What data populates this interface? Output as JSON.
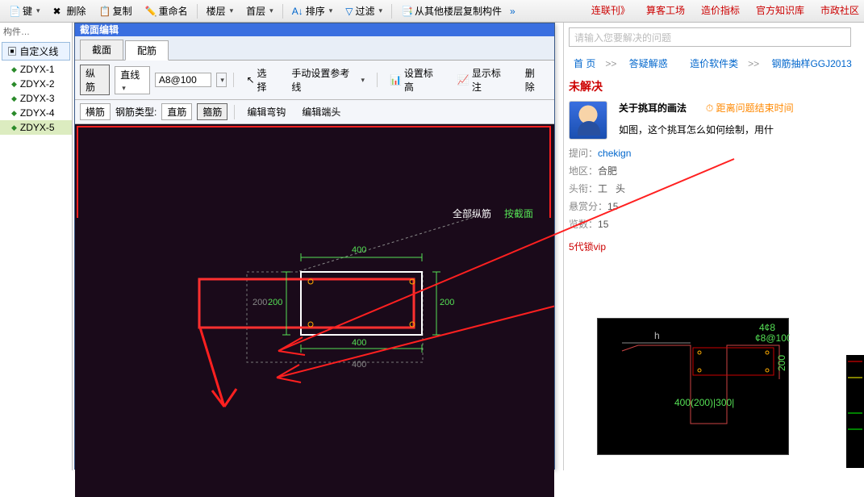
{
  "toolbar": {
    "new": "键",
    "delete": "删除",
    "copy": "复制",
    "rename": "重命名",
    "floor": "楼层",
    "firstfloor": "首层",
    "sort": "排序",
    "filter": "过滤",
    "copyfrom": "从其他楼层复制构件"
  },
  "rtlinks": [
    "连联刊》",
    "算客工场",
    "造价指标",
    "官方知识库",
    "市政社区"
  ],
  "left": {
    "hint": "构件…",
    "tree_head": "自定义线",
    "items": [
      "ZDYX-1",
      "ZDYX-2",
      "ZDYX-3",
      "ZDYX-4",
      "ZDYX-5"
    ]
  },
  "win": {
    "title": "截面编辑",
    "tab1": "截面",
    "tab2": "配筋",
    "row1": {
      "lbl1": "纵筋",
      "mode": "直线",
      "spec": "A8@100",
      "select": "选择",
      "manual": "手动设置参考线",
      "elev": "设置标高",
      "annot": "显示标注",
      "del": "删除"
    },
    "row2": {
      "lbl": "横筋",
      "typelbl": "钢筋类型:",
      "t1": "直筋",
      "t2": "箍筋",
      "edit1": "编辑弯钩",
      "edit2": "编辑端头"
    }
  },
  "canvas": {
    "label_all": "全部纵筋",
    "label_sec": "按截面",
    "dim400t": "400",
    "dim200l": "200",
    "dim200r": "200",
    "dim400b": "400",
    "dim400gray": "400",
    "dim200gray": "200"
  },
  "right": {
    "placeholder": "请输入您要解决的问题",
    "crumb": [
      "首 页",
      "答疑解惑",
      "造价软件类",
      "钢筋抽样GGJ2013"
    ],
    "status": "未解决",
    "title": "关于挑耳的画法",
    "distance": "距离问题结束时间",
    "body": "如图，这个挑耳怎么如何绘制，用什",
    "ask_lbl": "提问：",
    "ask_v": "chekign",
    "region_lbl": "地区：",
    "region_v": "合肥",
    "title_lbl": "头衔：",
    "title_v1": "工",
    "title_v2": "头",
    "points_lbl": "悬赏分：",
    "points_v": "15",
    "views_lbl": "览数：",
    "views_v": "15",
    "vip": "5代锁vip"
  },
  "thumb": {
    "h": "h",
    "d1": "4¢8",
    "d2": "¢8@100",
    "d3": "200",
    "d4": "400(200)|300|"
  }
}
